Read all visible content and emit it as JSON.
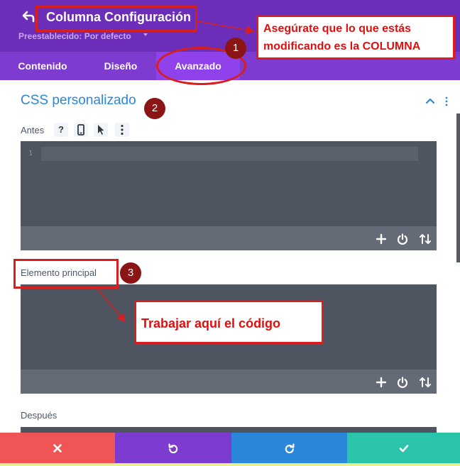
{
  "header": {
    "title": "Columna Configuración",
    "preset": "Preestablecido: Por defecto",
    "back_icon": "back-arrow-icon",
    "colors": {
      "header_bg": "#6c2eb9",
      "tabs_bg": "#7e3bd0",
      "active_tab_bg": "#8f42ec"
    }
  },
  "tabs": [
    {
      "label": "Contenido",
      "active": false
    },
    {
      "label": "Diseño",
      "active": false
    },
    {
      "label": "Avanzado",
      "active": true
    }
  ],
  "section": {
    "title": "CSS personalizado",
    "icons": [
      "chevron-up-icon",
      "kebab-menu-icon"
    ],
    "title_color": "#2b87da"
  },
  "fields": [
    {
      "label": "Antes",
      "icons": [
        "help-icon",
        "mobile-device-icon",
        "hover-pointer-icon",
        "more-options-icon"
      ],
      "line_number": "1",
      "tools": [
        "plus-icon",
        "power-icon",
        "sort-arrows-icon"
      ]
    },
    {
      "label": "Elemento principal",
      "tools": [
        "plus-icon",
        "power-icon",
        "sort-arrows-icon"
      ]
    },
    {
      "label": "Después"
    }
  ],
  "annotations": {
    "main_note_line1": "Asegúrate que lo que estás",
    "main_note_line2": "modificando es la COLUMNA",
    "code_note": "Trabajar aquí el código",
    "steps": [
      "1",
      "2",
      "3"
    ],
    "color": "#e00f0f"
  },
  "bottom_bar": {
    "buttons": [
      {
        "icon": "close-icon",
        "color": "#ef5555"
      },
      {
        "icon": "undo-icon",
        "color": "#7e3bd0"
      },
      {
        "icon": "redo-icon",
        "color": "#2b87da"
      },
      {
        "icon": "check-icon",
        "color": "#29c4a9"
      }
    ]
  }
}
